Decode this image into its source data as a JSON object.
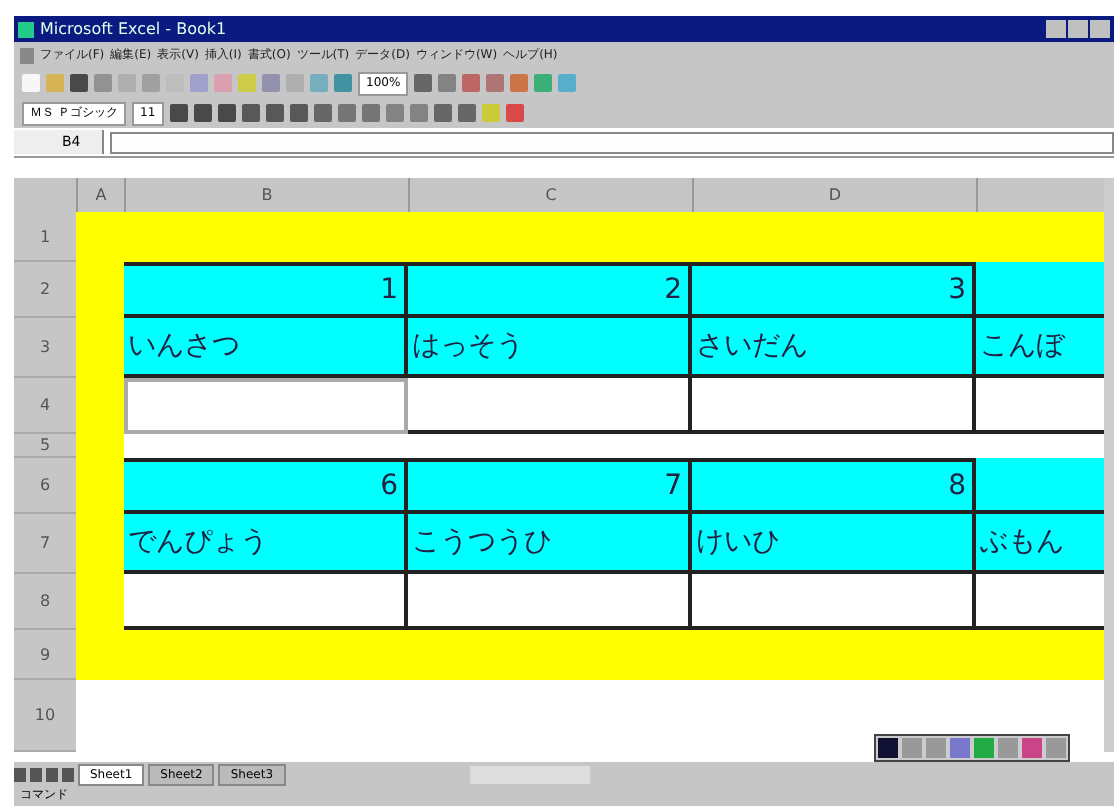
{
  "window": {
    "title": "Microsoft Excel - Book1"
  },
  "menu": [
    "ファイル(F)",
    "編集(E)",
    "表示(V)",
    "挿入(I)",
    "書式(O)",
    "ツール(T)",
    "データ(D)",
    "ウィンドウ(W)",
    "ヘルプ(H)"
  ],
  "format_toolbar": {
    "font": "ＭＳ Ｐゴシック",
    "size": "11"
  },
  "standard_toolbar": {
    "zoom": "100%"
  },
  "formula_bar": {
    "name_box": "B4"
  },
  "columns": [
    "A",
    "B",
    "C",
    "D"
  ],
  "rows": [
    {
      "label": "1",
      "kind": "band"
    },
    {
      "label": "2",
      "kind": "numbers",
      "cells": [
        "1",
        "2",
        "3"
      ]
    },
    {
      "label": "3",
      "kind": "words",
      "cells": [
        "いんさつ",
        "はっそう",
        "さいだん",
        "こんぼ"
      ]
    },
    {
      "label": "4",
      "kind": "blank",
      "cells": [
        {
          "selected": true
        },
        {
          "selected": false
        },
        {
          "selected": false
        },
        {
          "selected": false
        }
      ]
    },
    {
      "label": "5",
      "kind": "gap"
    },
    {
      "label": "6",
      "kind": "numbers",
      "cells": [
        "6",
        "7",
        "8"
      ]
    },
    {
      "label": "7",
      "kind": "words",
      "cells": [
        "でんぴょう",
        "こうつうひ",
        "けいひ",
        "ぶもん"
      ]
    },
    {
      "label": "8",
      "kind": "blank",
      "cells": [
        {
          "selected": false
        },
        {
          "selected": false
        },
        {
          "selected": false
        },
        {
          "selected": false
        }
      ]
    },
    {
      "label": "9",
      "kind": "band"
    },
    {
      "label": "10",
      "kind": "empty"
    }
  ],
  "sheet_tabs": [
    {
      "label": "Sheet1",
      "selected": true
    },
    {
      "label": "Sheet2",
      "selected": false
    },
    {
      "label": "Sheet3",
      "selected": false
    }
  ],
  "status_bar": "コマンド"
}
